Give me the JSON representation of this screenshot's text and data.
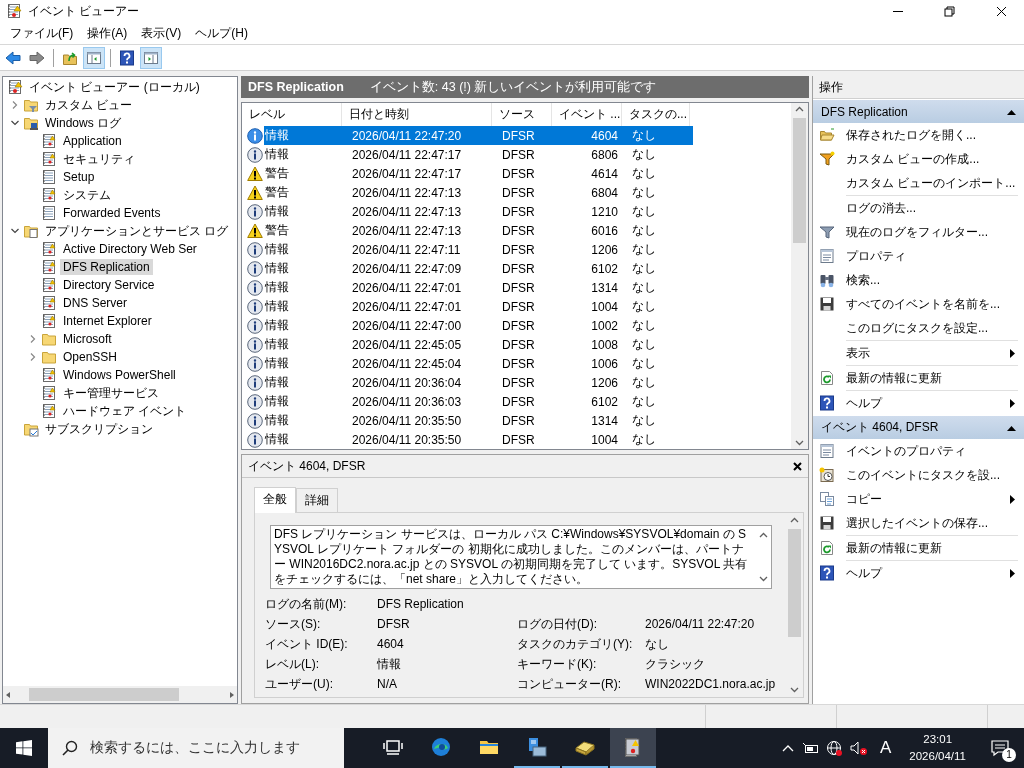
{
  "window": {
    "title": "イベント ビューアー"
  },
  "menu": [
    "ファイル(F)",
    "操作(A)",
    "表示(V)",
    "ヘルプ(H)"
  ],
  "toolbar": [
    [
      {
        "kind": "back",
        "pressed": false
      },
      {
        "kind": "forward",
        "pressed": false
      }
    ],
    [
      {
        "kind": "up-folder",
        "pressed": false
      },
      {
        "kind": "tree-pane",
        "pressed": true
      }
    ],
    [
      {
        "kind": "help",
        "pressed": false
      },
      {
        "kind": "action-pane",
        "pressed": true
      }
    ]
  ],
  "tree": [
    {
      "label": "イベント ビューアー (ローカル)",
      "kind": "viewer",
      "selected": false,
      "children": [
        {
          "label": "カスタム ビュー",
          "kind": "filter-folder",
          "expanded": false,
          "selected": false
        },
        {
          "label": "Windows ログ",
          "kind": "computer-folder",
          "expanded": true,
          "selected": false,
          "children": [
            {
              "label": "Application",
              "kind": "log",
              "selected": false
            },
            {
              "label": "セキュリティ",
              "kind": "log",
              "selected": false
            },
            {
              "label": "Setup",
              "kind": "plain-log",
              "selected": false
            },
            {
              "label": "システム",
              "kind": "log",
              "selected": false
            },
            {
              "label": "Forwarded Events",
              "kind": "plain-log",
              "selected": false
            }
          ]
        },
        {
          "label": "アプリケーションとサービス ログ",
          "kind": "page-folder",
          "expanded": true,
          "selected": false,
          "children": [
            {
              "label": "Active Directory Web Ser",
              "kind": "log",
              "selected": false
            },
            {
              "label": "DFS Replication",
              "kind": "log",
              "selected": true
            },
            {
              "label": "Directory Service",
              "kind": "log",
              "selected": false
            },
            {
              "label": "DNS Server",
              "kind": "log",
              "selected": false
            },
            {
              "label": "Internet Explorer",
              "kind": "log",
              "selected": false
            },
            {
              "label": "Microsoft",
              "kind": "folder",
              "expanded": false,
              "selected": false
            },
            {
              "label": "OpenSSH",
              "kind": "folder",
              "expanded": false,
              "selected": false
            },
            {
              "label": "Windows PowerShell",
              "kind": "log",
              "selected": false
            },
            {
              "label": "キー管理サービス",
              "kind": "log",
              "selected": false
            },
            {
              "label": "ハードウェア イベント",
              "kind": "log",
              "selected": false
            }
          ]
        },
        {
          "label": "サブスクリプション",
          "kind": "subscription",
          "selected": false
        }
      ]
    }
  ],
  "events": {
    "title": "DFS Replication",
    "summary": "イベント数: 43 (!) 新しいイベントが利用可能です",
    "columns": [
      "レベル",
      "日付と時刻",
      "ソース",
      "イベント ...",
      "タスクの..."
    ],
    "rows": [
      {
        "kind": "info",
        "level": "情報",
        "date": "2026/04/11 22:47:20",
        "source": "DFSR",
        "id": "4604",
        "task": "なし",
        "selected": true
      },
      {
        "kind": "info",
        "level": "情報",
        "date": "2026/04/11 22:47:17",
        "source": "DFSR",
        "id": "6806",
        "task": "なし",
        "selected": false
      },
      {
        "kind": "warning",
        "level": "警告",
        "date": "2026/04/11 22:47:17",
        "source": "DFSR",
        "id": "4614",
        "task": "なし",
        "selected": false
      },
      {
        "kind": "warning",
        "level": "警告",
        "date": "2026/04/11 22:47:13",
        "source": "DFSR",
        "id": "6804",
        "task": "なし",
        "selected": false
      },
      {
        "kind": "info",
        "level": "情報",
        "date": "2026/04/11 22:47:13",
        "source": "DFSR",
        "id": "1210",
        "task": "なし",
        "selected": false
      },
      {
        "kind": "warning",
        "level": "警告",
        "date": "2026/04/11 22:47:13",
        "source": "DFSR",
        "id": "6016",
        "task": "なし",
        "selected": false
      },
      {
        "kind": "info",
        "level": "情報",
        "date": "2026/04/11 22:47:11",
        "source": "DFSR",
        "id": "1206",
        "task": "なし",
        "selected": false
      },
      {
        "kind": "info",
        "level": "情報",
        "date": "2026/04/11 22:47:09",
        "source": "DFSR",
        "id": "6102",
        "task": "なし",
        "selected": false
      },
      {
        "kind": "info",
        "level": "情報",
        "date": "2026/04/11 22:47:01",
        "source": "DFSR",
        "id": "1314",
        "task": "なし",
        "selected": false
      },
      {
        "kind": "info",
        "level": "情報",
        "date": "2026/04/11 22:47:01",
        "source": "DFSR",
        "id": "1004",
        "task": "なし",
        "selected": false
      },
      {
        "kind": "info",
        "level": "情報",
        "date": "2026/04/11 22:47:00",
        "source": "DFSR",
        "id": "1002",
        "task": "なし",
        "selected": false
      },
      {
        "kind": "info",
        "level": "情報",
        "date": "2026/04/11 22:45:05",
        "source": "DFSR",
        "id": "1008",
        "task": "なし",
        "selected": false
      },
      {
        "kind": "info",
        "level": "情報",
        "date": "2026/04/11 22:45:04",
        "source": "DFSR",
        "id": "1006",
        "task": "なし",
        "selected": false
      },
      {
        "kind": "info",
        "level": "情報",
        "date": "2026/04/11 20:36:04",
        "source": "DFSR",
        "id": "1206",
        "task": "なし",
        "selected": false
      },
      {
        "kind": "info",
        "level": "情報",
        "date": "2026/04/11 20:36:03",
        "source": "DFSR",
        "id": "6102",
        "task": "なし",
        "selected": false
      },
      {
        "kind": "info",
        "level": "情報",
        "date": "2026/04/11 20:35:50",
        "source": "DFSR",
        "id": "1314",
        "task": "なし",
        "selected": false
      },
      {
        "kind": "info",
        "level": "情報",
        "date": "2026/04/11 20:35:50",
        "source": "DFSR",
        "id": "1004",
        "task": "なし",
        "selected": false
      }
    ]
  },
  "detail": {
    "title": "イベント 4604, DFSR",
    "tabs": [
      {
        "label": "全般",
        "selected": true
      },
      {
        "label": "詳細",
        "selected": false
      }
    ],
    "description": "DFS レプリケーション サービスは、ローカル パス C:¥Windows¥SYSVOL¥domain の SYSVOL レプリケート フォルダーの 初期化に成功しました。このメンバーは、パートナー WIN2016DC2.nora.ac.jp との SYSVOL の初期同期を完了して います。SYSVOL 共有をチェックするには、「net share」と入力してください。",
    "fields": [
      {
        "left": {
          "label": "ログの名前(M):",
          "value": "DFS Replication"
        }
      },
      {
        "left": {
          "label": "ソース(S):",
          "value": "DFSR"
        },
        "right": {
          "label": "ログの日付(D):",
          "value": "2026/04/11 22:47:20"
        }
      },
      {
        "left": {
          "label": "イベント ID(E):",
          "value": "4604"
        },
        "right": {
          "label": "タスクのカテゴリ(Y):",
          "value": "なし"
        }
      },
      {
        "left": {
          "label": "レベル(L):",
          "value": "情報"
        },
        "right": {
          "label": "キーワード(K):",
          "value": "クラシック"
        }
      },
      {
        "left": {
          "label": "ユーザー(U):",
          "value": "N/A"
        },
        "right": {
          "label": "コンピューター(R):",
          "value": "WIN2022DC1.nora.ac.jp"
        }
      }
    ]
  },
  "actions": {
    "title": "操作",
    "sections": [
      {
        "title": "DFS Replication",
        "expanded": true,
        "groups": [
          [
            {
              "label": "保存されたログを開く...",
              "kind": "open-folder",
              "submenu": false
            },
            {
              "label": "カスタム ビューの作成...",
              "kind": "funnel-new",
              "submenu": false
            },
            {
              "label": "カスタム ビューのインポート...",
              "submenu": false
            }
          ],
          [
            {
              "label": "ログの消去...",
              "submenu": false
            },
            {
              "label": "現在のログをフィルター...",
              "kind": "funnel",
              "submenu": false
            },
            {
              "label": "プロパティ",
              "kind": "properties",
              "submenu": false
            },
            {
              "label": "検索...",
              "kind": "binoculars",
              "submenu": false
            },
            {
              "label": "すべてのイベントを名前を...",
              "kind": "floppy",
              "submenu": false
            },
            {
              "label": "このログにタスクを設定...",
              "submenu": false
            }
          ],
          [
            {
              "label": "表示",
              "submenu": true
            }
          ],
          [
            {
              "label": "最新の情報に更新",
              "kind": "refresh",
              "submenu": false
            }
          ],
          [
            {
              "label": "ヘルプ",
              "kind": "help",
              "submenu": true
            }
          ]
        ]
      },
      {
        "title": "イベント 4604, DFSR",
        "expanded": true,
        "groups": [
          [
            {
              "label": "イベントのプロパティ",
              "kind": "properties",
              "submenu": false
            },
            {
              "label": "このイベントにタスクを設...",
              "kind": "clock",
              "submenu": false
            },
            {
              "label": "コピー",
              "kind": "copy",
              "submenu": true
            },
            {
              "label": "選択したイベントの保存...",
              "kind": "floppy",
              "submenu": false
            }
          ],
          [
            {
              "label": "最新の情報に更新",
              "kind": "refresh",
              "submenu": false
            }
          ],
          [
            {
              "label": "ヘルプ",
              "kind": "help",
              "submenu": true
            }
          ]
        ]
      }
    ]
  },
  "taskbar": {
    "search_placeholder": "検索するには、ここに入力します",
    "apps": [
      {
        "kind": "task-view",
        "running": false,
        "active": false
      },
      {
        "kind": "browser",
        "running": false,
        "active": false
      },
      {
        "kind": "file-folder",
        "running": false,
        "active": false
      },
      {
        "kind": "server",
        "running": true,
        "active": false
      },
      {
        "kind": "book",
        "running": true,
        "active": false
      },
      {
        "kind": "event-log",
        "running": true,
        "active": true
      }
    ],
    "ime": "A",
    "time": "23:01",
    "date": "2026/04/11",
    "notifications": "1"
  }
}
